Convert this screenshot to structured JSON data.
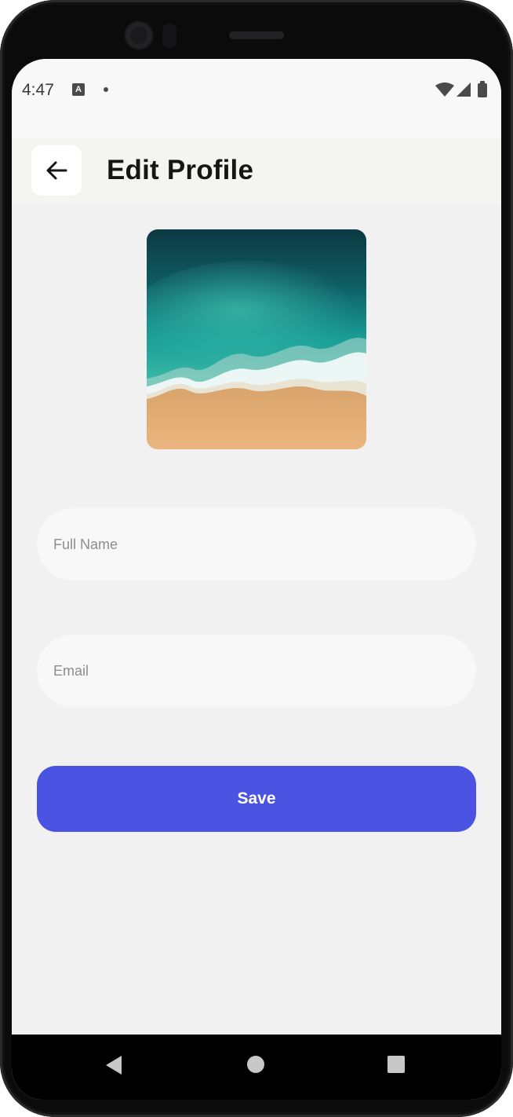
{
  "status_bar": {
    "time": "4:47",
    "icons": [
      "text-a-icon",
      "notification-dot-icon",
      "wifi-icon",
      "cell-signal-icon",
      "battery-icon"
    ]
  },
  "app_bar": {
    "back_icon": "arrow-left-icon",
    "title": "Edit Profile"
  },
  "profile": {
    "image": "beach-wave-aerial-photo"
  },
  "form": {
    "full_name": {
      "value": "",
      "placeholder": "Full Name"
    },
    "email": {
      "value": "",
      "placeholder": "Email"
    },
    "save_label": "Save"
  },
  "colors": {
    "accent": "#4b54e2",
    "background": "#f1f1f1",
    "field_background": "#f8f8f8",
    "title": "#151515"
  },
  "nav_bar": {
    "buttons": [
      "nav-back-icon",
      "nav-home-icon",
      "nav-recents-icon"
    ]
  }
}
